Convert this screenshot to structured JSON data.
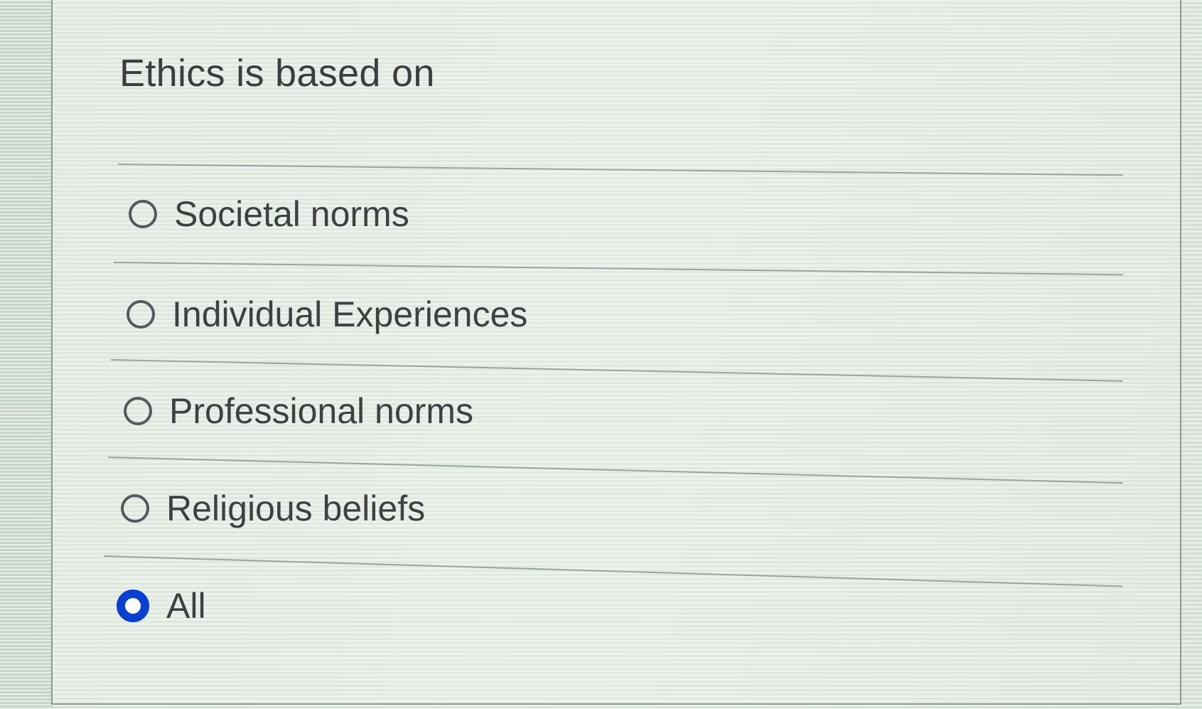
{
  "question": {
    "text": "Ethics is based on"
  },
  "options": [
    {
      "label": "Societal norms",
      "selected": false
    },
    {
      "label": "Individual Experiences",
      "selected": false
    },
    {
      "label": "Professional norms",
      "selected": false
    },
    {
      "label": "Religious beliefs",
      "selected": false
    },
    {
      "label": "All",
      "selected": true
    }
  ],
  "colors": {
    "selected_radio": "#0a3fd0",
    "text": "#3e4042"
  }
}
